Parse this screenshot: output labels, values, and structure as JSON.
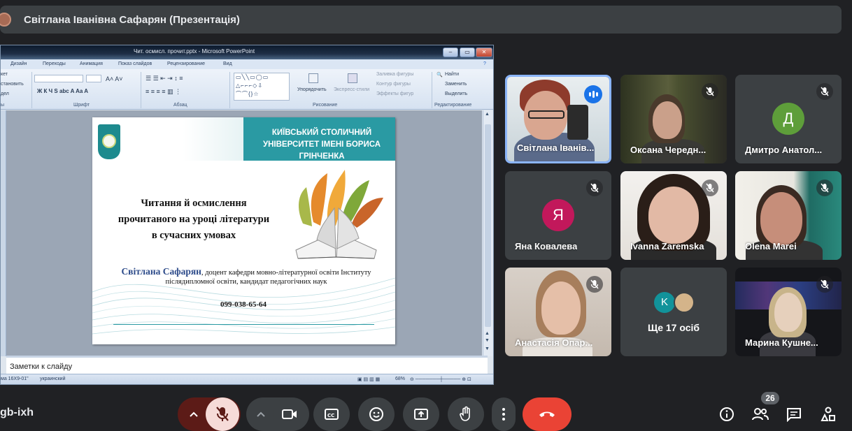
{
  "header": {
    "title": "Світлана Іванівна Сафарян (Презентація)"
  },
  "presentation": {
    "window_title": "Чит. осмисл. прочит.pptx - Microsoft PowerPoint",
    "menu_tabs": [
      "Дизайн",
      "Переходы",
      "Анимация",
      "Показ слайдов",
      "Рецензирование",
      "Вид"
    ],
    "ribbon": {
      "groups": [
        "Шрифт",
        "Абзац",
        "Рисование",
        "Редактирование"
      ],
      "clipped_left": [
        "кет",
        "становить",
        "дел",
        "ы"
      ],
      "arrange": "Упорядочить",
      "express_styles": "Экспресс-стили",
      "fill": "Заливка фигуры",
      "outline": "Контур фигуры",
      "effects": "Эффекты фигур",
      "find": "Найти",
      "replace": "Заменить",
      "select": "Выделить"
    },
    "slide": {
      "university": "КИЇВСЬКИЙ СТОЛИЧНИЙ УНІВЕРСИТЕТ ІМЕНІ БОРИСА ГРІНЧЕНКА",
      "title_line1": "Читання  й осмислення",
      "title_line2": "прочитаного  на уроці літератури",
      "title_line3": "в сучасних  умовах",
      "author": "Світлана Сафарян",
      "author_desc": ", доцент кафедри мовно-літературної освіти Інституту післядипломної освіти, кандидат педагогічних наук",
      "phone": "099-038-65-64"
    },
    "notes_placeholder": "Заметки к слайду",
    "status": {
      "slide": "ма 16X9-01\"",
      "language": "украинский",
      "zoom": "68%"
    }
  },
  "participants": [
    {
      "name": "Світлана Іванів...",
      "speaking": true
    },
    {
      "name": "Оксана Чередн...",
      "muted": true
    },
    {
      "name": "Дмитро Анатол...",
      "initial": "Д",
      "color": "#5e9e3a",
      "muted": true
    },
    {
      "name": "Яна Ковалева",
      "initial": "Я",
      "color": "#c2185b",
      "muted": true
    },
    {
      "name": "Ivanna Zaremska",
      "muted": true
    },
    {
      "name": "Olena Marei",
      "muted": true
    },
    {
      "name": "Анастасія Опар...",
      "muted": true
    },
    {
      "name": "Ще 17 осіб",
      "initial": "K",
      "color": "#12939a"
    },
    {
      "name": "Марина Кушне...",
      "muted": true
    }
  ],
  "bottom_bar": {
    "meeting_code": "gb-ixh",
    "people_count": "26",
    "icons": [
      "chevron-up-icon",
      "mic-off-icon",
      "chevron-up-icon",
      "camera-icon",
      "captions-icon",
      "emoji-icon",
      "present-icon",
      "raise-hand-icon",
      "more-icon",
      "end-call-icon",
      "info-icon",
      "people-icon",
      "chat-icon",
      "activities-icon"
    ],
    "colors": {
      "mic_off_bg": "#f6dbd8",
      "end_call": "#ea4335",
      "dark_red": "#5c1b17"
    }
  }
}
